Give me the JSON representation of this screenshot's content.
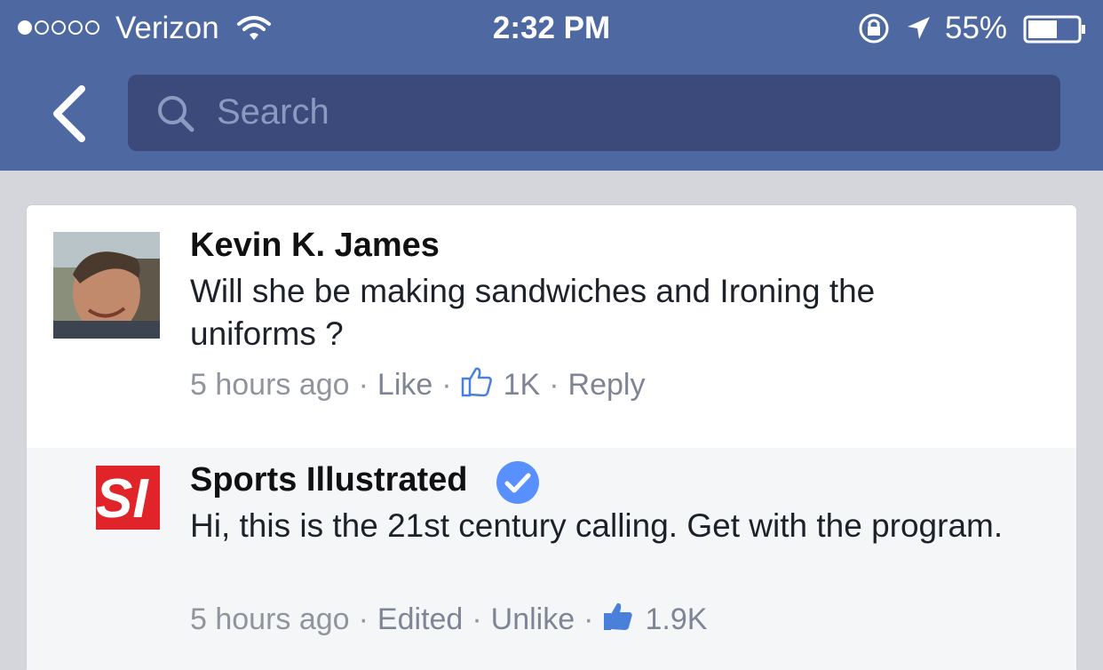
{
  "status_bar": {
    "carrier": "Verizon",
    "time": "2:32 PM",
    "battery_percent": "55%",
    "signal_bars_filled": 1,
    "signal_bars_total": 5
  },
  "nav": {
    "search_placeholder": "Search"
  },
  "comments": [
    {
      "author": "Kevin K. James",
      "text": "Will she be making sandwiches and Ironing the uniforms ?",
      "time": "5 hours ago",
      "actions": [
        "Like",
        "Reply"
      ],
      "likes": "1K"
    },
    {
      "author": "Sports Illustrated",
      "verified": true,
      "logo_text": "SI",
      "text": "Hi, this is the 21st century calling. Get with the program.",
      "time": "5 hours ago",
      "edited_label": "Edited",
      "actions": [
        "Unlike"
      ],
      "likes": "1.9K"
    }
  ],
  "colors": {
    "header": "#4e69a2",
    "search_box": "#3b4a7a",
    "like_blue": "#4a80d9",
    "verified_blue": "#5890ff",
    "si_red": "#e0242a"
  }
}
